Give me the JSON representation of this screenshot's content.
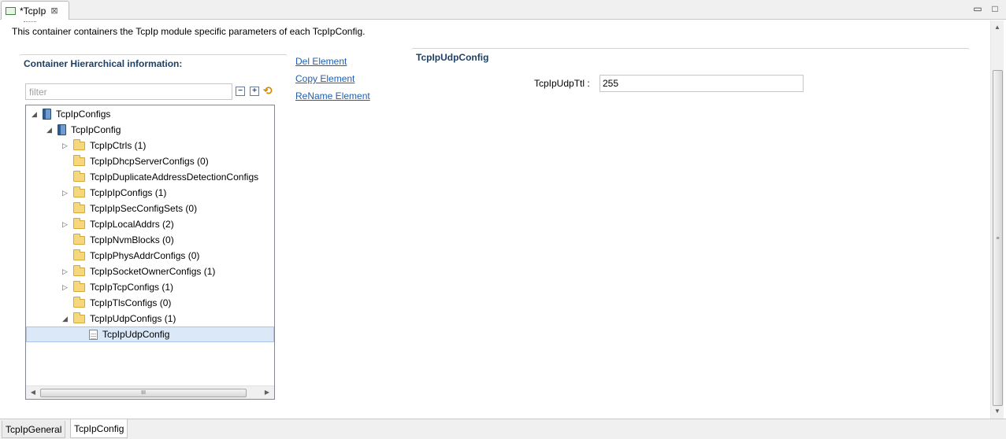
{
  "editor": {
    "tab_title": "*TcpIp",
    "tab_close": "⊠",
    "minimize": "▭",
    "maximize": "□"
  },
  "description": "This container containers the TcpIp module specific parameters of each TcpIpConfig.",
  "left_panel": {
    "section_title": "Container Hierarchical information:",
    "filter_placeholder": "filter",
    "collapse_all": "−",
    "expand_all": "+",
    "sync": "⟲"
  },
  "tree": {
    "nodes": [
      {
        "label": "TcpIpConfigs",
        "icon": "book-icon",
        "level": 0,
        "twisty": "expanded"
      },
      {
        "label": "TcpIpConfig",
        "icon": "book-icon",
        "level": 1,
        "twisty": "expanded"
      },
      {
        "label": "TcpIpCtrls (1)",
        "icon": "folder-icon",
        "level": 2,
        "twisty": "collapsed"
      },
      {
        "label": "TcpIpDhcpServerConfigs (0)",
        "icon": "folder-icon",
        "level": 2,
        "twisty": "none"
      },
      {
        "label": "TcpIpDuplicateAddressDetectionConfigs",
        "icon": "folder-icon",
        "level": 2,
        "twisty": "none"
      },
      {
        "label": "TcpIpIpConfigs (1)",
        "icon": "folder-icon",
        "level": 2,
        "twisty": "collapsed"
      },
      {
        "label": "TcpIpIpSecConfigSets (0)",
        "icon": "folder-icon",
        "level": 2,
        "twisty": "none"
      },
      {
        "label": "TcpIpLocalAddrs (2)",
        "icon": "folder-icon",
        "level": 2,
        "twisty": "collapsed"
      },
      {
        "label": "TcpIpNvmBlocks (0)",
        "icon": "folder-icon",
        "level": 2,
        "twisty": "none"
      },
      {
        "label": "TcpIpPhysAddrConfigs (0)",
        "icon": "folder-icon",
        "level": 2,
        "twisty": "none"
      },
      {
        "label": "TcpIpSocketOwnerConfigs (1)",
        "icon": "folder-icon",
        "level": 2,
        "twisty": "collapsed"
      },
      {
        "label": "TcpIpTcpConfigs (1)",
        "icon": "folder-icon",
        "level": 2,
        "twisty": "collapsed"
      },
      {
        "label": "TcpIpTlsConfigs (0)",
        "icon": "folder-icon",
        "level": 2,
        "twisty": "none"
      },
      {
        "label": "TcpIpUdpConfigs (1)",
        "icon": "folder-icon",
        "level": 2,
        "twisty": "expanded"
      },
      {
        "label": "TcpIpUdpConfig",
        "icon": "page-icon",
        "level": 3,
        "twisty": "none",
        "selected": true
      }
    ],
    "hscroll_grip": "III"
  },
  "actions": {
    "delete": "Del Element",
    "copy": "Copy Element",
    "rename": "ReName Element"
  },
  "right_panel": {
    "section_title": "TcpIpUdpConfig",
    "field_label": "TcpIpUdpTtl :",
    "field_value": "255"
  },
  "vscroll_grip": "≡",
  "page_tabs": [
    {
      "label": "TcpIpGeneral",
      "active": false
    },
    {
      "label": "TcpIpConfig",
      "active": true
    }
  ]
}
